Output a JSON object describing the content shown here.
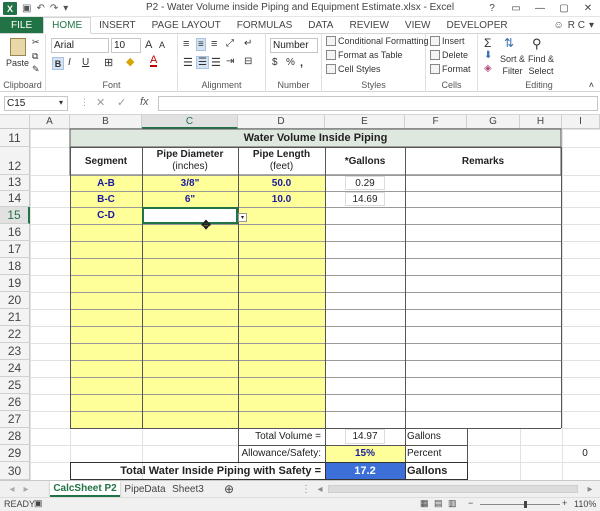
{
  "window": {
    "title": "P2 - Water Volume inside Piping and Equipment Estimate.xlsx - Excel",
    "app_logo": "X",
    "controls": [
      "?",
      "▭",
      "—",
      "▢",
      "✕"
    ]
  },
  "user": {
    "name": "R C",
    "avatar": "☺"
  },
  "ribbon_tabs": [
    "FILE",
    "HOME",
    "INSERT",
    "PAGE LAYOUT",
    "FORMULAS",
    "DATA",
    "REVIEW",
    "VIEW",
    "DEVELOPER"
  ],
  "ribbon": {
    "clipboard": {
      "label": "Clipboard",
      "paste": "Paste"
    },
    "font": {
      "label": "Font",
      "name": "Arial",
      "size": "10",
      "bold": "B",
      "italic": "I",
      "underline": "U",
      "grow": "A",
      "shrink": "A",
      "color_letter": "A"
    },
    "alignment": {
      "label": "Alignment"
    },
    "number": {
      "label": "Number",
      "format": "Number",
      "dollar": "$",
      "percent": "%",
      "comma": ","
    },
    "styles": {
      "label": "Styles",
      "conditional": "Conditional Formatting",
      "table": "Format as Table",
      "cell_styles": "Cell Styles"
    },
    "cells": {
      "label": "Cells",
      "insert": "Insert",
      "delete": "Delete",
      "format": "Format"
    },
    "editing": {
      "label": "Editing",
      "sum": "Σ",
      "sort": "Sort &",
      "filter": "Filter",
      "find": "Find &",
      "select": "Select"
    }
  },
  "formula_bar": {
    "name_box": "C15",
    "fx": "fx",
    "value": ""
  },
  "columns": [
    "A",
    "B",
    "C",
    "D",
    "E",
    "F",
    "G",
    "H",
    "I"
  ],
  "rows": [
    "11",
    "12",
    "13",
    "14",
    "15",
    "16",
    "17",
    "18",
    "19",
    "20",
    "21",
    "22",
    "23",
    "24",
    "25",
    "26",
    "27",
    "28",
    "29",
    "30"
  ],
  "sheet": {
    "title": "Water Volume Inside Piping",
    "headers": {
      "segment": "Segment",
      "diameter": "Pipe Diameter",
      "diameter_unit": "(inches)",
      "length": "Pipe Length",
      "length_unit": "(feet)",
      "gallons": "*Gallons",
      "remarks": "Remarks"
    },
    "data_rows": [
      {
        "segment": "A-B",
        "diameter": "3/8\"",
        "length": "50.0",
        "gallons": "0.29"
      },
      {
        "segment": "B-C",
        "diameter": "6\"",
        "length": "10.0",
        "gallons": "14.69"
      },
      {
        "segment": "C-D",
        "diameter": "",
        "length": "",
        "gallons": ""
      }
    ],
    "total_volume_label": "Total Volume =",
    "total_volume": "14.97",
    "total_volume_unit": "Gallons",
    "allowance_label": "Allowance/Safety:",
    "allowance": "15%",
    "allowance_unit": "Percent",
    "grand_total_label": "Total Water Inside Piping with Safety =",
    "grand_total": "17.2",
    "grand_total_unit": "Gallons",
    "stray_value": "0"
  },
  "sheet_tabs": [
    "CalcSheet P2",
    "PipeData",
    "Sheet3"
  ],
  "status": {
    "mode": "READY",
    "zoom": "110%"
  }
}
